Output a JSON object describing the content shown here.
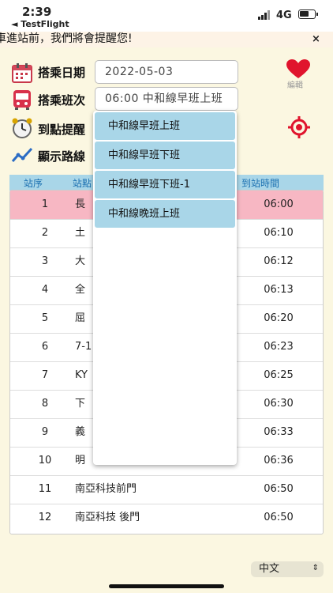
{
  "status_bar": {
    "time": "2:39",
    "back_app": "◄ TestFlight",
    "network": "4G"
  },
  "banner": {
    "text": "車進站前，我們將會提醒您!",
    "close": "×"
  },
  "form": {
    "date_label": "搭乘日期",
    "date_value": "2022-05-03",
    "trip_label": "搭乘班次",
    "trip_value": "06:00 中和線早班上班",
    "alert_label": "到點提醒",
    "route_label": "顯示路線",
    "edit_label": "編輯"
  },
  "table": {
    "headers": [
      "站序",
      "站點",
      "到站時間"
    ],
    "rows": [
      {
        "seq": "1",
        "stop": "長",
        "time": "06:00"
      },
      {
        "seq": "2",
        "stop": "土",
        "time": "06:10"
      },
      {
        "seq": "3",
        "stop": "大",
        "time": "06:12"
      },
      {
        "seq": "4",
        "stop": "全",
        "time": "06:13"
      },
      {
        "seq": "5",
        "stop": "屈",
        "time": "06:20"
      },
      {
        "seq": "6",
        "stop": "7-1",
        "time": "06:23"
      },
      {
        "seq": "7",
        "stop": "KY",
        "time": "06:25"
      },
      {
        "seq": "8",
        "stop": "下",
        "time": "06:30"
      },
      {
        "seq": "9",
        "stop": "義",
        "time": "06:33"
      },
      {
        "seq": "10",
        "stop": "明",
        "time": "06:36"
      },
      {
        "seq": "11",
        "stop": "南亞科技前門",
        "time": "06:50"
      },
      {
        "seq": "12",
        "stop": "南亞科技 後門",
        "time": "06:50"
      }
    ]
  },
  "dropdown": {
    "options": [
      "中和線早班上班",
      "中和線早班下班",
      "中和線早班下班-1",
      "中和線晚班上班"
    ]
  },
  "language": {
    "selected": "中文"
  },
  "colors": {
    "accent": "#e0142d",
    "header": "#a9d6e8",
    "highlight": "#f7b7c3",
    "background": "#fbf7e1"
  }
}
